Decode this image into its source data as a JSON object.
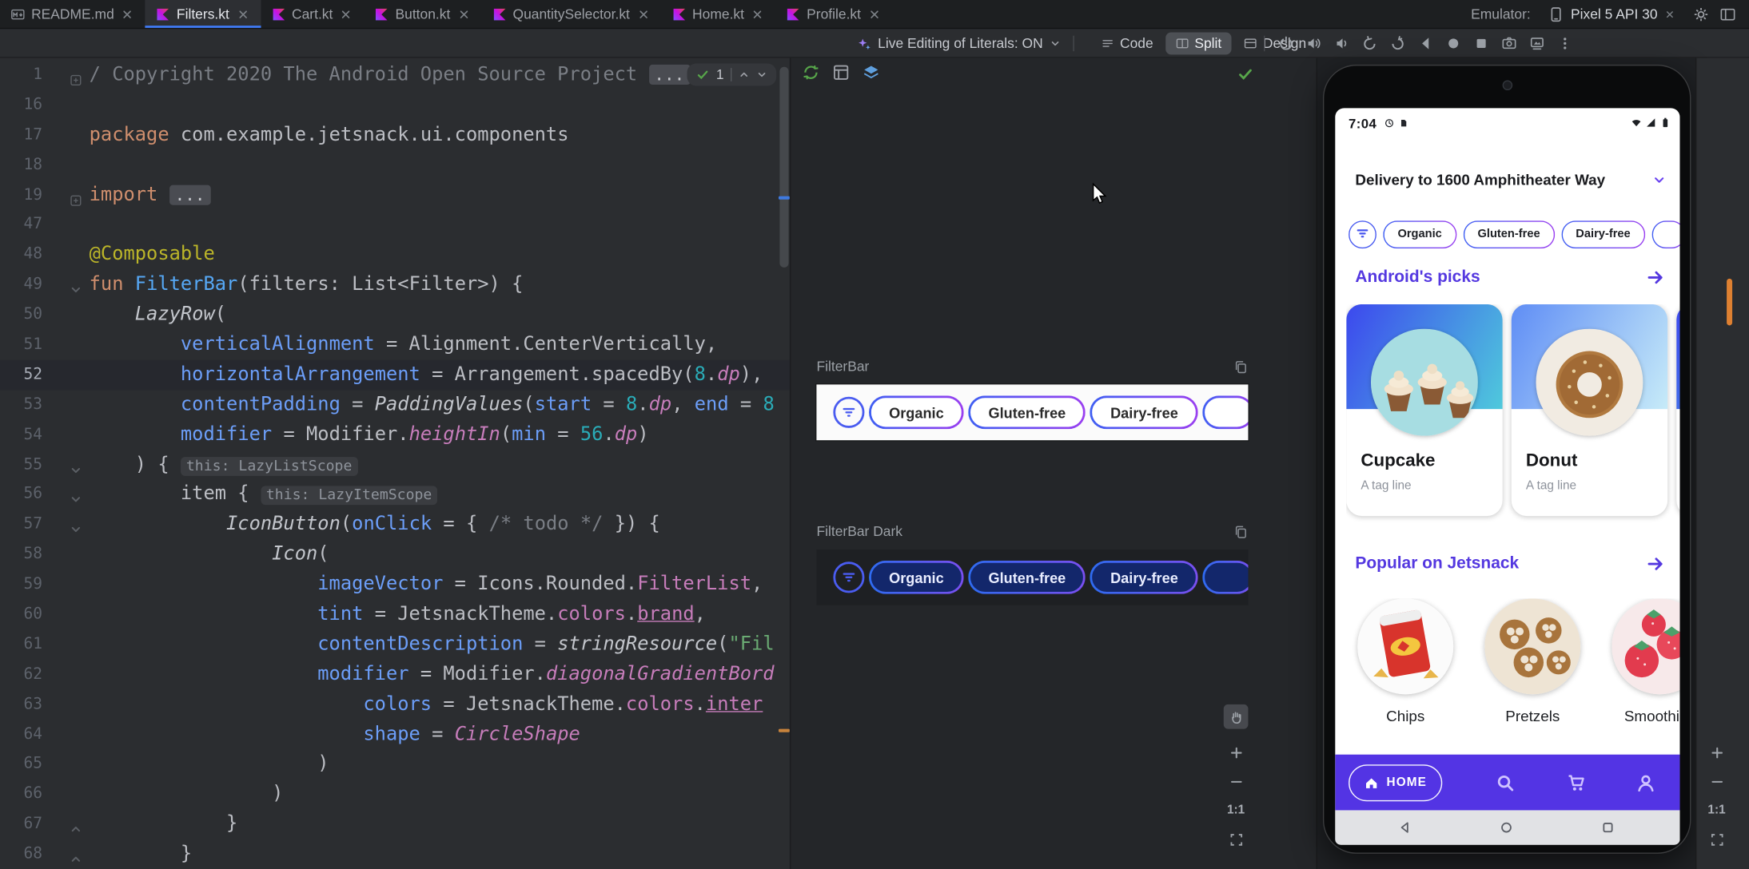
{
  "tabbar": {
    "tabs": [
      {
        "label": "README.md",
        "icon": "markdown",
        "active": false
      },
      {
        "label": "Filters.kt",
        "icon": "kotlin",
        "active": true
      },
      {
        "label": "Cart.kt",
        "icon": "kotlin",
        "active": false
      },
      {
        "label": "Button.kt",
        "icon": "kotlin",
        "active": false
      },
      {
        "label": "QuantitySelector.kt",
        "icon": "kotlin",
        "active": false
      },
      {
        "label": "Home.kt",
        "icon": "kotlin",
        "active": false
      },
      {
        "label": "Profile.kt",
        "icon": "kotlin",
        "active": false
      }
    ],
    "emulator_label": "Emulator:",
    "device_tab": "Pixel 5 API 30"
  },
  "toolbar": {
    "live_editing": "Live Editing of Literals: ON",
    "modes": [
      {
        "label": "Code",
        "icon": "code",
        "active": false
      },
      {
        "label": "Split",
        "icon": "split",
        "active": true
      },
      {
        "label": "Design",
        "icon": "design",
        "active": false
      }
    ],
    "emulator_icons": [
      "power",
      "volume-up",
      "volume-down",
      "rotate-left",
      "rotate-right",
      "back",
      "home",
      "overview",
      "screenshot",
      "snapshots",
      "more"
    ]
  },
  "editor": {
    "current_line": "52",
    "inspections": {
      "count": "1"
    },
    "folds": {
      "1": "plus",
      "19": "plus",
      "49": "down",
      "55": "down",
      "56": "down",
      "57": "down",
      "67": "up",
      "68": "up"
    },
    "lines": [
      {
        "n": "1",
        "seg": [
          [
            "com",
            "/ Copyright 2020 The Android Open Source Project "
          ],
          [
            "fold",
            "..."
          ]
        ]
      },
      {
        "n": "16",
        "seg": []
      },
      {
        "n": "17",
        "seg": [
          [
            "k",
            "package"
          ],
          [
            "pl",
            " com.example.jetsnack.ui.components"
          ]
        ]
      },
      {
        "n": "18",
        "seg": []
      },
      {
        "n": "19",
        "seg": [
          [
            "k",
            "import"
          ],
          [
            "pl",
            " "
          ],
          [
            "fold",
            "..."
          ]
        ]
      },
      {
        "n": "47",
        "seg": []
      },
      {
        "n": "48",
        "seg": [
          [
            "ann",
            "@Composable"
          ]
        ]
      },
      {
        "n": "49",
        "seg": [
          [
            "k",
            "fun"
          ],
          [
            "pl",
            " "
          ],
          [
            "fn",
            "FilterBar"
          ],
          [
            "pl",
            "(filters: List<Filter>) {"
          ]
        ]
      },
      {
        "n": "50",
        "seg": [
          [
            "pl",
            "    "
          ],
          [
            "call",
            "LazyRow"
          ],
          [
            "pl",
            "("
          ]
        ]
      },
      {
        "n": "51",
        "seg": [
          [
            "pl",
            "        "
          ],
          [
            "arg",
            "verticalAlignment"
          ],
          [
            "pl",
            " = Alignment.CenterVertically,"
          ]
        ]
      },
      {
        "n": "52",
        "seg": [
          [
            "pl",
            "        "
          ],
          [
            "arg",
            "horizontalArrangement"
          ],
          [
            "pl",
            " = Arrangement.spacedBy("
          ],
          [
            "num",
            "8"
          ],
          [
            "pl",
            "."
          ],
          [
            "ext",
            "dp"
          ],
          [
            "pl",
            "),"
          ]
        ]
      },
      {
        "n": "53",
        "seg": [
          [
            "pl",
            "        "
          ],
          [
            "arg",
            "contentPadding"
          ],
          [
            "pl",
            " = "
          ],
          [
            "call",
            "PaddingValues"
          ],
          [
            "pl",
            "("
          ],
          [
            "arg",
            "start"
          ],
          [
            "pl",
            " = "
          ],
          [
            "num",
            "8"
          ],
          [
            "pl",
            "."
          ],
          [
            "ext",
            "dp"
          ],
          [
            "pl",
            ", "
          ],
          [
            "arg",
            "end"
          ],
          [
            "pl",
            " = "
          ],
          [
            "num",
            "8"
          ]
        ]
      },
      {
        "n": "54",
        "seg": [
          [
            "pl",
            "        "
          ],
          [
            "arg",
            "modifier"
          ],
          [
            "pl",
            " = Modifier."
          ],
          [
            "ext",
            "heightIn"
          ],
          [
            "pl",
            "("
          ],
          [
            "arg",
            "min"
          ],
          [
            "pl",
            " = "
          ],
          [
            "num",
            "56"
          ],
          [
            "pl",
            "."
          ],
          [
            "ext",
            "dp"
          ],
          [
            "pl",
            ")"
          ]
        ]
      },
      {
        "n": "55",
        "seg": [
          [
            "pl",
            "    ) { "
          ],
          [
            "inlay",
            "this: LazyListScope"
          ]
        ]
      },
      {
        "n": "56",
        "seg": [
          [
            "pl",
            "        item { "
          ],
          [
            "inlay",
            "this: LazyItemScope"
          ]
        ]
      },
      {
        "n": "57",
        "seg": [
          [
            "pl",
            "            "
          ],
          [
            "call",
            "IconButton"
          ],
          [
            "pl",
            "("
          ],
          [
            "arg",
            "onClick"
          ],
          [
            "pl",
            " = { "
          ],
          [
            "com",
            "/* todo */"
          ],
          [
            "pl",
            " }) {"
          ]
        ]
      },
      {
        "n": "58",
        "seg": [
          [
            "pl",
            "                "
          ],
          [
            "call",
            "Icon"
          ],
          [
            "pl",
            "("
          ]
        ]
      },
      {
        "n": "59",
        "seg": [
          [
            "pl",
            "                    "
          ],
          [
            "arg",
            "imageVector"
          ],
          [
            "pl",
            " = Icons.Rounded."
          ],
          [
            "prop",
            "FilterList"
          ],
          [
            "pl",
            ","
          ]
        ]
      },
      {
        "n": "60",
        "seg": [
          [
            "pl",
            "                    "
          ],
          [
            "arg",
            "tint"
          ],
          [
            "pl",
            " = JetsnackTheme."
          ],
          [
            "prop",
            "colors"
          ],
          [
            "pl",
            "."
          ],
          [
            "propu",
            "brand"
          ],
          [
            "pl",
            ","
          ]
        ]
      },
      {
        "n": "61",
        "seg": [
          [
            "pl",
            "                    "
          ],
          [
            "arg",
            "contentDescription"
          ],
          [
            "pl",
            " = "
          ],
          [
            "call",
            "stringResource"
          ],
          [
            "pl",
            "("
          ],
          [
            "str",
            "\"Fil"
          ]
        ]
      },
      {
        "n": "62",
        "seg": [
          [
            "pl",
            "                    "
          ],
          [
            "arg",
            "modifier"
          ],
          [
            "pl",
            " = Modifier."
          ],
          [
            "ext",
            "diagonalGradientBord"
          ]
        ]
      },
      {
        "n": "63",
        "seg": [
          [
            "pl",
            "                        "
          ],
          [
            "arg",
            "colors"
          ],
          [
            "pl",
            " = JetsnackTheme."
          ],
          [
            "prop",
            "colors"
          ],
          [
            "pl",
            "."
          ],
          [
            "propu",
            "inter"
          ]
        ]
      },
      {
        "n": "64",
        "seg": [
          [
            "pl",
            "                        "
          ],
          [
            "arg",
            "shape"
          ],
          [
            "pl",
            " = "
          ],
          [
            "ext",
            "CircleShape"
          ]
        ]
      },
      {
        "n": "65",
        "seg": [
          [
            "pl",
            "                    )"
          ]
        ]
      },
      {
        "n": "66",
        "seg": [
          [
            "pl",
            "                )"
          ]
        ]
      },
      {
        "n": "67",
        "seg": [
          [
            "pl",
            "            }"
          ]
        ]
      },
      {
        "n": "68",
        "seg": [
          [
            "pl",
            "        }"
          ]
        ]
      }
    ]
  },
  "preview": {
    "toolbar_icons": [
      "build-refresh",
      "ui-check",
      "layers"
    ],
    "status_icon": "check",
    "sections": [
      {
        "label": "FilterBar",
        "theme": "light",
        "chips": [
          "Organic",
          "Gluten-free",
          "Dairy-free",
          ""
        ]
      },
      {
        "label": "FilterBar Dark",
        "theme": "dark",
        "chips": [
          "Organic",
          "Gluten-free",
          "Dairy-free",
          ""
        ]
      }
    ],
    "zoom": {
      "one": "1:1"
    }
  },
  "emulator": {
    "status": {
      "time": "7:04"
    },
    "delivery": "Delivery to 1600 Amphitheater Way",
    "chips": [
      "Organic",
      "Gluten-free",
      "Dairy-free",
      ""
    ],
    "picks": {
      "title": "Android's picks",
      "items": [
        {
          "name": "Cupcake",
          "tag": "A tag line",
          "img": "cupcake"
        },
        {
          "name": "Donut",
          "tag": "A tag line",
          "img": "donut"
        },
        {
          "name": "",
          "tag": "",
          "img": "card3"
        }
      ]
    },
    "popular": {
      "title": "Popular on Jetsnack",
      "items": [
        {
          "name": "Chips",
          "img": "chips"
        },
        {
          "name": "Pretzels",
          "img": "pretzels"
        },
        {
          "name": "Smoothies",
          "img": "smoothie"
        }
      ]
    },
    "nav": {
      "home_label": "HOME"
    }
  },
  "strip": {
    "zoom_one": "1:1"
  },
  "colors": {
    "accent_blue": "#3f79f2",
    "brand_purple": "#5438e0",
    "nav_purple": "#5334e4",
    "chip_border_start": "#3e5ff2",
    "chip_border_end": "#9a3ff0",
    "stripe_orange": "#de8031"
  }
}
